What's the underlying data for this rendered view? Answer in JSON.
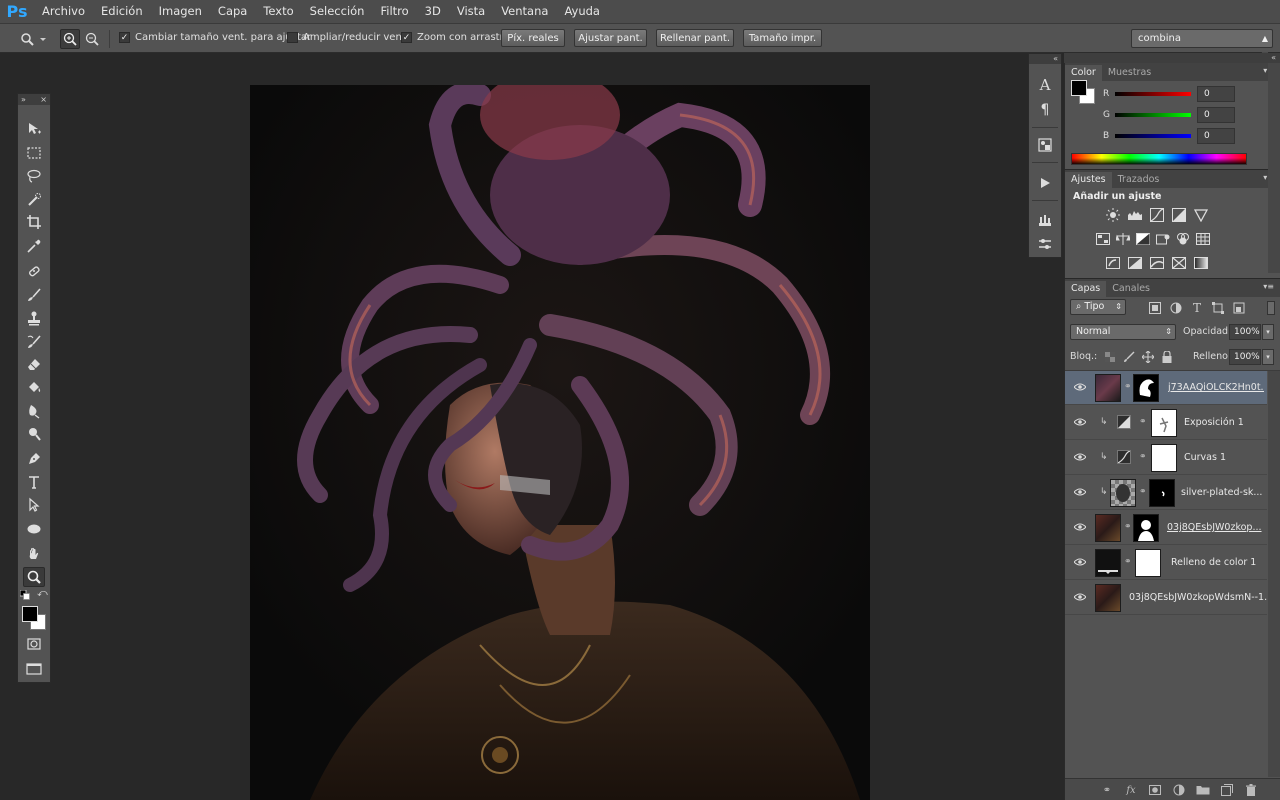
{
  "app": {
    "logo": "Ps",
    "menu": [
      "Archivo",
      "Edición",
      "Imagen",
      "Capa",
      "Texto",
      "Selección",
      "Filtro",
      "3D",
      "Vista",
      "Ventana",
      "Ayuda"
    ]
  },
  "options": {
    "check_resize": "Cambiar tamaño vent. para ajustar",
    "check_zoom_all": "Ampliar/reducir vent.",
    "check_scrubby": "Zoom con arrastre",
    "btn_actual": "Píx. reales",
    "btn_fit": "Ajustar pant.",
    "btn_fill": "Rellenar pant.",
    "btn_print": "Tamaño impr.",
    "workspace": "combina"
  },
  "color_panel": {
    "tabs": [
      "Color",
      "Muestras"
    ],
    "r_label": "R",
    "g_label": "G",
    "b_label": "B",
    "r": "0",
    "g": "0",
    "b": "0"
  },
  "adjustments_panel": {
    "tabs": [
      "Ajustes",
      "Trazados"
    ],
    "title": "Añadir un ajuste"
  },
  "layers_panel": {
    "tabs": [
      "Capas",
      "Canales"
    ],
    "filter": "Tipo",
    "blend_mode": "Normal",
    "opacity_label": "Opacidad:",
    "opacity": "100%",
    "lock_label": "Bloq.:",
    "fill_label": "Relleno:",
    "fill": "100%",
    "layers": [
      {
        "name": "j73AAQiOLCK2Hn0t..."
      },
      {
        "name": "Exposición 1"
      },
      {
        "name": "Curvas 1"
      },
      {
        "name": "silver-plated-sk..."
      },
      {
        "name": "03j8QEsbJW0zkop..."
      },
      {
        "name": "Relleno de color 1"
      },
      {
        "name": "03j8QEsbJW0zkopWdsmN--1..."
      }
    ]
  }
}
